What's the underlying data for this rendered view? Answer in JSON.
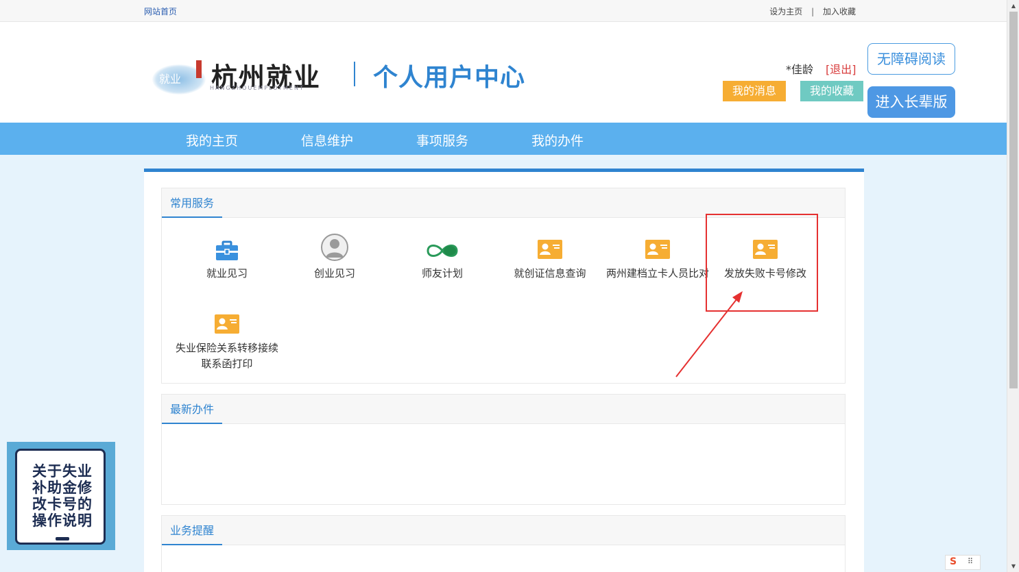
{
  "topbar": {
    "home_link": "网站首页",
    "set_home": "设为主页",
    "separator": "|",
    "add_fav": "加入收藏"
  },
  "header": {
    "logo_text": "杭州就业",
    "logo_sub": "HANGZHOUEMPLOYMENT",
    "logo_badge": "就业",
    "page_title": "个人用户中心",
    "user_name": "*佳龄",
    "logout": "[退出]",
    "my_messages": "我的消息",
    "my_favorites": "我的收藏",
    "accessible_read": "无障碍阅读",
    "elder_version": "进入长辈版"
  },
  "nav": {
    "items": [
      "我的主页",
      "信息维护",
      "事项服务",
      "我的办件"
    ]
  },
  "panels": {
    "common": {
      "title": "常用服务",
      "services": [
        {
          "label": "就业见习",
          "icon": "briefcase-icon"
        },
        {
          "label": "创业见习",
          "icon": "person-avatar-icon"
        },
        {
          "label": "师友计划",
          "icon": "infinity-icon"
        },
        {
          "label": "就创证信息查询",
          "icon": "id-card-icon"
        },
        {
          "label": "两州建档立卡人员比对",
          "icon": "id-card-icon"
        },
        {
          "label": "发放失败卡号修改",
          "icon": "id-card-icon"
        },
        {
          "label": "失业保险关系转移接续",
          "label2": "联系函打印",
          "icon": "id-card-icon"
        }
      ]
    },
    "latest": {
      "title": "最新办件"
    },
    "reminder": {
      "title": "业务提醒"
    }
  },
  "float_ad": {
    "text": "关于失业补助金修改卡号的操作说明"
  },
  "ime": {
    "logo": "S",
    "dots": "⠿"
  },
  "colors": {
    "primary": "#2f84d0",
    "nav": "#5bb0ee",
    "orange": "#f6ad33",
    "teal": "#6fcac2",
    "highlight": "#e53030"
  }
}
